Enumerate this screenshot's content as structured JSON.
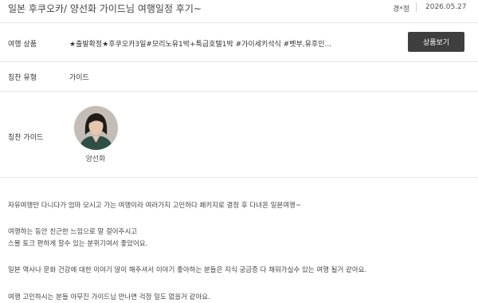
{
  "header": {
    "title": "일본 후쿠오카/ 양선화 가이드님 여행일정 후기~",
    "author": "경*정",
    "date": "2026.05.27"
  },
  "product": {
    "label": "여행 상품",
    "value": "★출발확정★후쿠오카3일#모리노유1박+특급호텔1박 #가이세키석식 #벳부,유후인...",
    "button_label": "상품보기"
  },
  "praise_type": {
    "label": "칭찬 유형",
    "value": "가이드"
  },
  "praise_guide": {
    "label": "칭찬 가이드",
    "name": "양선화"
  },
  "review": {
    "paragraphs": [
      "자유여행만 다니다가 엄마 모시고 가는 여행이라 여러가지 고민하다 패키지로 결정 후 다녀온 일본여행~",
      "여행하는 동안 친근한 느낌으로 말 걸어주시고",
      "스몰 토크 편하게 할수 있는 분위기여서 좋았어요.",
      "일본 역사나 문화 건강에 대한 이야기 많이 해주셔서 이야기 좋아하는 분들은 지식 궁금증 다 채워가실수 있는 여행 될거 같아요.",
      "여행 고민하시는 분들 아무진 가이드님 만나면 걱정 일도 없을거 같아요."
    ]
  }
}
